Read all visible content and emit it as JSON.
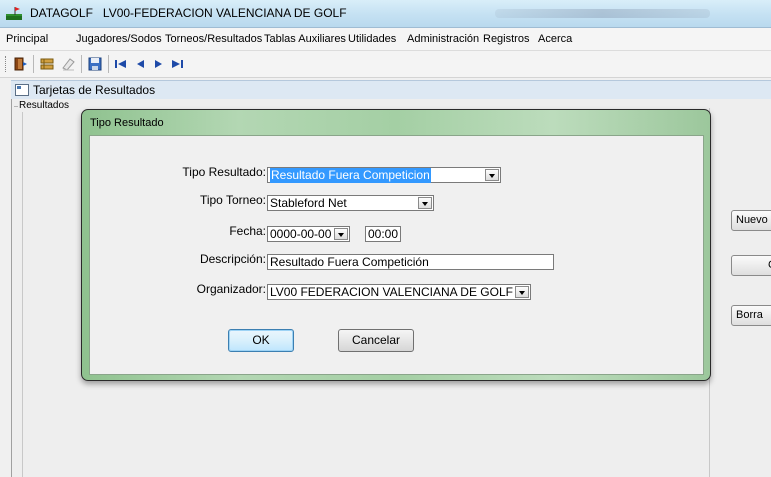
{
  "window": {
    "title_app": "DATAGOLF",
    "title_doc": "LV00-FEDERACION VALENCIANA DE GOLF"
  },
  "menu": [
    "Principal",
    "Jugadores/Sodos",
    "Torneos/Resultados",
    "Tablas Auxiliares",
    "Utilidades",
    "Administración",
    "Registros",
    "Acerca"
  ],
  "toolbar": {
    "icons": [
      "exit-door-icon",
      "tools-icon",
      "eraser-icon",
      "save-disk-icon",
      "first-record-icon",
      "previous-record-icon",
      "next-record-icon",
      "last-record-icon"
    ]
  },
  "internal_frame": {
    "title": "Tarjetas de Resultados",
    "section_label": "Resultados",
    "side_buttons": [
      "Nuevo",
      "G",
      "Borra"
    ]
  },
  "dialog": {
    "title": "Tipo Resultado",
    "fields": {
      "tipo_resultado": {
        "label": "Tipo Resultado:",
        "value": "Resultado Fuera Competicion"
      },
      "tipo_torneo": {
        "label": "Tipo Torneo:",
        "value": "Stableford Net"
      },
      "fecha": {
        "label": "Fecha:",
        "value": "0000-00-00",
        "time": "00:00"
      },
      "descripcion": {
        "label": "Descripción:",
        "value": "Resultado Fuera Competición"
      },
      "organizador": {
        "label": "Organizador:",
        "value": "LV00 FEDERACION VALENCIANA DE GOLF"
      }
    },
    "ok_label": "OK",
    "cancel_label": "Cancelar"
  },
  "colors": {
    "dialog_frame": "#a4cfa4",
    "selection": "#3399ff",
    "titlebar": "#c6e2f3"
  }
}
